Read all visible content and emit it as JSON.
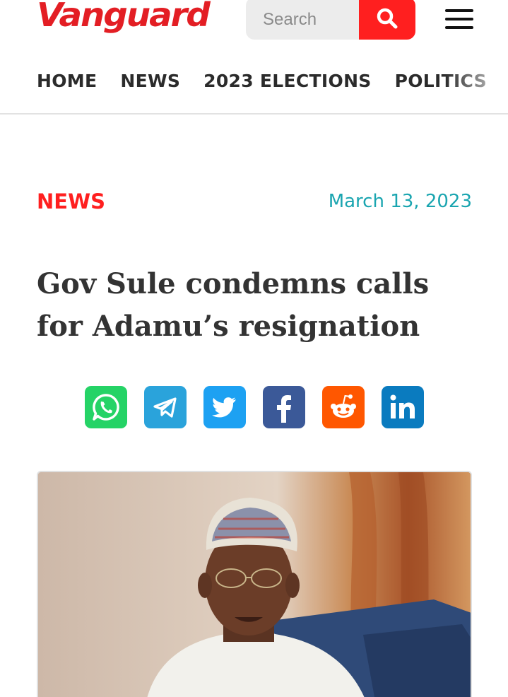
{
  "header": {
    "logo_text": "Vanguard",
    "search": {
      "placeholder": "Search",
      "button_icon": "search-icon"
    },
    "menu_icon": "hamburger-menu-icon"
  },
  "nav": {
    "items": [
      {
        "label": "HOME"
      },
      {
        "label": "NEWS"
      },
      {
        "label": "2023 ELECTIONS"
      },
      {
        "label": "POLITICS"
      }
    ]
  },
  "article": {
    "category": "NEWS",
    "date": "March 13, 2023",
    "headline": "Gov Sule condemns calls for Adamu’s resignation",
    "share_buttons": [
      {
        "name": "whatsapp",
        "icon": "whatsapp-icon",
        "color": "#25d366"
      },
      {
        "name": "telegram",
        "icon": "telegram-icon",
        "color": "#2aa3db"
      },
      {
        "name": "twitter",
        "icon": "twitter-icon",
        "color": "#1da1f2"
      },
      {
        "name": "facebook",
        "icon": "facebook-icon",
        "color": "#3b5998"
      },
      {
        "name": "reddit",
        "icon": "reddit-icon",
        "color": "#ff5700"
      },
      {
        "name": "linkedin",
        "icon": "linkedin-icon",
        "color": "#0a7bbf"
      }
    ]
  },
  "colors": {
    "brand": "#e31e24",
    "accent_red": "#ff1f1f",
    "date_teal": "#1aa5b0",
    "nav_text": "#2b2b2b"
  }
}
